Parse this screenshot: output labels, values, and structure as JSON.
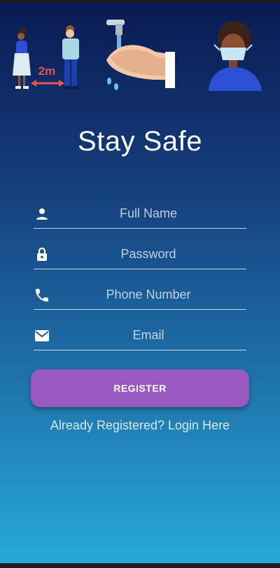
{
  "app": {
    "title": "Stay Safe",
    "illustration": {
      "distance_label": "2m",
      "icons": [
        "social-distancing-icon",
        "handwashing-icon",
        "face-mask-icon"
      ]
    }
  },
  "form": {
    "fields": [
      {
        "icon": "person-icon",
        "placeholder": "Full Name"
      },
      {
        "icon": "lock-icon",
        "placeholder": "Password"
      },
      {
        "icon": "phone-icon",
        "placeholder": "Phone Number"
      },
      {
        "icon": "mail-icon",
        "placeholder": "Email"
      }
    ],
    "register_label": "REGISTER",
    "login_link": "Already Registered? Login Here"
  },
  "colors": {
    "background_top": "#0a1a52",
    "background_bottom": "#27a8d6",
    "button": "#9b59c0",
    "text": "#ffffff"
  }
}
